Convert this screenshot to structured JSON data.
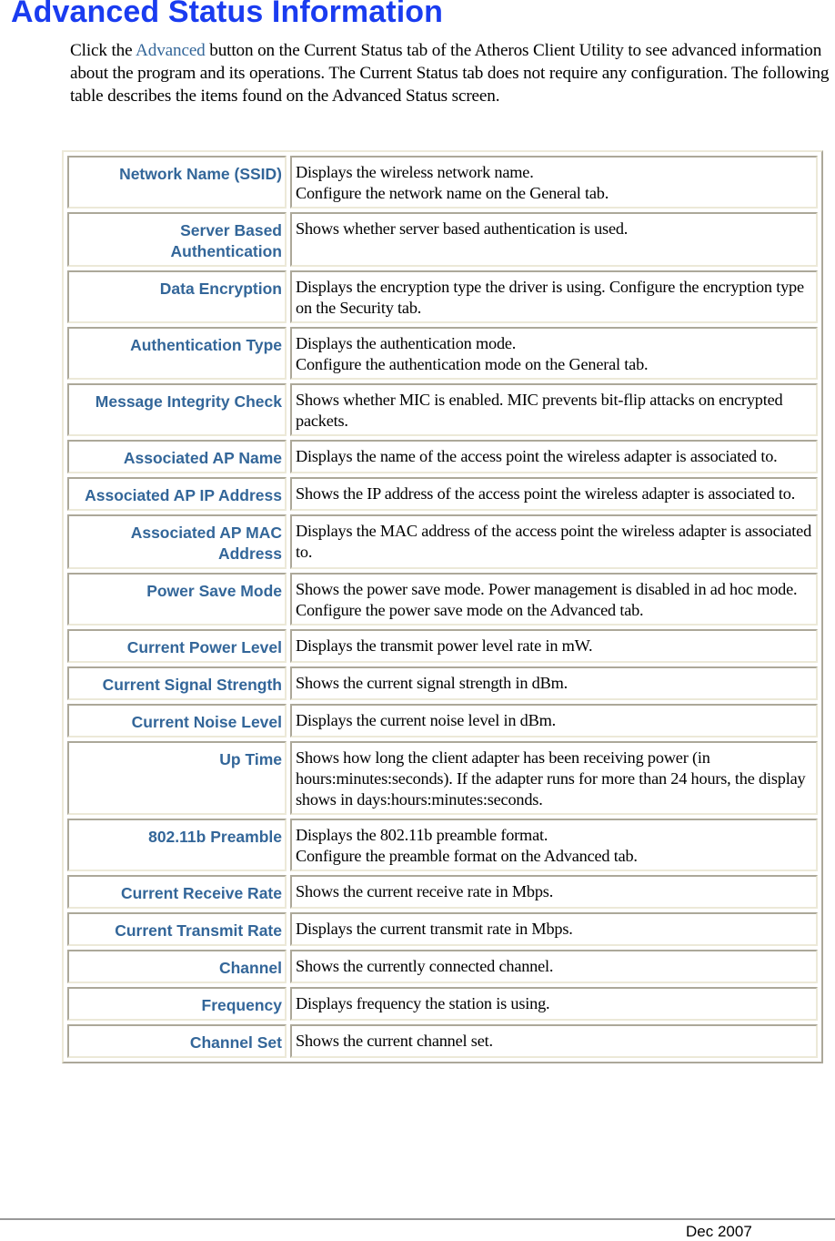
{
  "header": {
    "title": "Advanced Status Information"
  },
  "intro": {
    "before_link": "Click the ",
    "link_text": "Advanced",
    "after_link": " button on the Current Status tab of the Atheros Client Utility to see advanced information about the program and its operations. The Current Status tab does not require any configuration.  The following table describes the items found on the Advanced Status screen."
  },
  "table": {
    "rows": [
      {
        "term": "Network Name (SSID)",
        "lines": [
          "Displays the wireless network name.",
          "Configure the network name on the General tab."
        ]
      },
      {
        "term": "Server Based Authentication",
        "lines": [
          "Shows whether server based authentication is used."
        ]
      },
      {
        "term": "Data Encryption",
        "lines": [
          "Displays the encryption type the driver is using.   Configure the encryption type on the Security tab."
        ]
      },
      {
        "term": "Authentication Type",
        "lines": [
          "Displays the authentication mode.",
          "Configure the authentication mode on the General tab."
        ]
      },
      {
        "term": "Message Integrity Check",
        "lines": [
          "Shows whether MIC is enabled. MIC prevents bit-flip attacks on encrypted packets."
        ]
      },
      {
        "term": "Associated AP Name",
        "lines": [
          "Displays the name of the access point the wireless adapter is associated to."
        ]
      },
      {
        "term": "Associated AP IP Address",
        "lines": [
          "Shows the IP address of the access point the wireless adapter is associated to."
        ]
      },
      {
        "term": "Associated AP MAC Address",
        "lines": [
          "Displays the MAC address of the access point the wireless adapter is associated to."
        ]
      },
      {
        "term": "Power Save Mode",
        "lines": [
          "Shows the power save mode. Power management is disabled in ad hoc mode.",
          "Configure the power save mode on the Advanced tab."
        ]
      },
      {
        "term": "Current Power Level",
        "lines": [
          "Displays the transmit power level rate in mW."
        ]
      },
      {
        "term": "Current Signal Strength",
        "lines": [
          "Shows the current signal strength in dBm."
        ]
      },
      {
        "term": "Current Noise Level",
        "lines": [
          "Displays the current noise level in dBm."
        ]
      },
      {
        "term": "Up Time",
        "lines": [
          "Shows how long the client adapter has been receiving power (in hours:minutes:seconds). If the adapter runs for more than 24 hours, the display shows in days:hours:minutes:seconds."
        ]
      },
      {
        "term": "802.11b Preamble",
        "lines": [
          "Displays the 802.11b preamble format.",
          "Configure the preamble format on the Advanced tab."
        ]
      },
      {
        "term": "Current Receive Rate",
        "lines": [
          "Shows the current receive rate in Mbps."
        ]
      },
      {
        "term": "Current Transmit Rate",
        "lines": [
          "Displays the current transmit rate in Mbps."
        ]
      },
      {
        "term": "Channel",
        "lines": [
          "Shows the currently connected channel."
        ]
      },
      {
        "term": "Frequency",
        "lines": [
          "Displays frequency the station is using."
        ]
      },
      {
        "term": "Channel Set",
        "lines": [
          "Shows the current channel set."
        ]
      }
    ]
  },
  "footer": {
    "date": "Dec 2007"
  },
  "colors": {
    "title": "#1a3cf0",
    "term": "#336699",
    "link": "#336699"
  }
}
